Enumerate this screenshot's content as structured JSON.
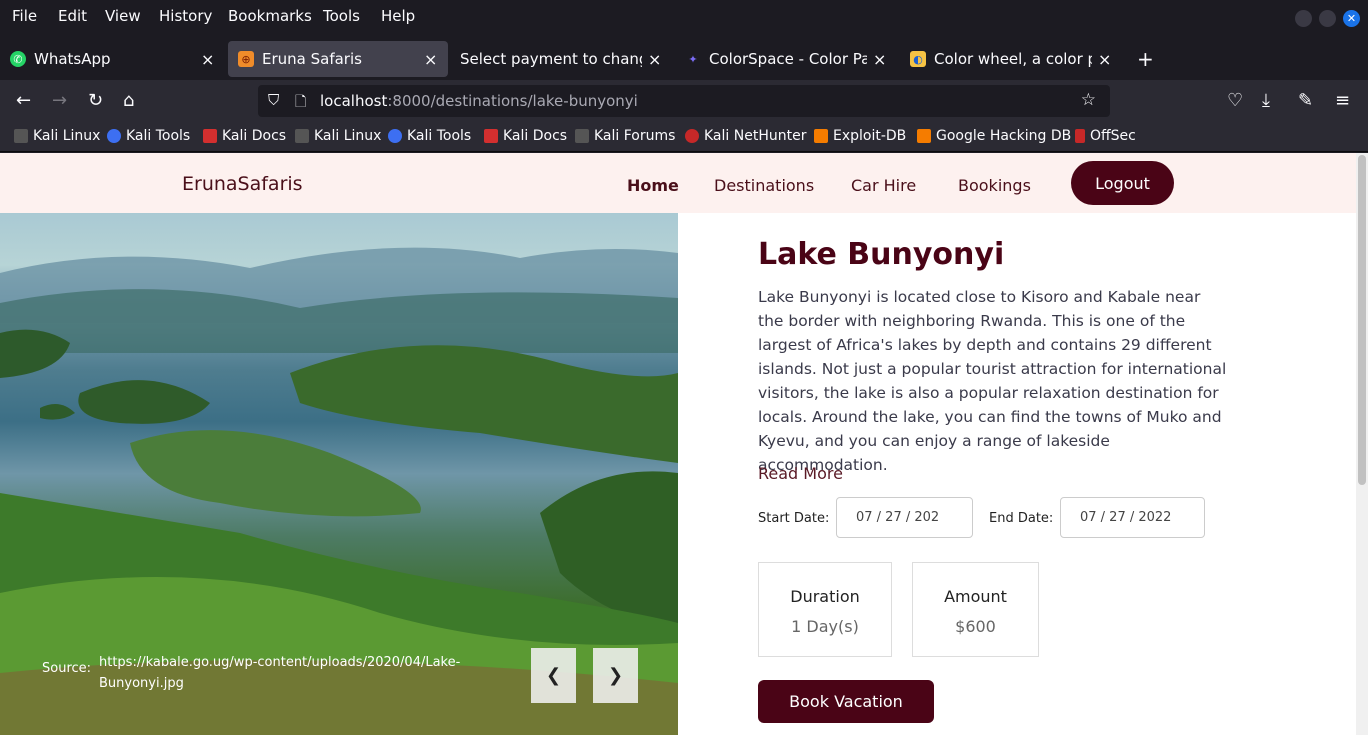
{
  "menu": [
    "File",
    "Edit",
    "View",
    "History",
    "Bookmarks",
    "Tools",
    "Help"
  ],
  "tabs": [
    {
      "label": "WhatsApp",
      "icon": "whatsapp-icon"
    },
    {
      "label": "Eruna Safaris",
      "icon": "site-favicon"
    },
    {
      "label": "Select payment to change | D",
      "icon": "none"
    },
    {
      "label": "ColorSpace - Color Palett",
      "icon": "colorspace-icon"
    },
    {
      "label": "Color wheel, a color palet",
      "icon": "colorwheel-icon"
    }
  ],
  "url": {
    "host": "localhost",
    "path": ":8000/destinations/lake-bunyonyi"
  },
  "bookmarks": [
    "Kali Linux",
    "Kali Tools",
    "Kali Docs",
    "Kali Linux",
    "Kali Tools",
    "Kali Docs",
    "Kali Forums",
    "Kali NetHunter",
    "Exploit-DB",
    "Google Hacking DB",
    "OffSec"
  ],
  "site": {
    "brand": "ErunaSafaris",
    "nav": [
      "Home",
      "Destinations",
      "Car Hire",
      "Bookings"
    ],
    "logout": "Logout"
  },
  "hero": {
    "source_label": "Source:",
    "source_url": "https://kabale.go.ug/wp-content/uploads/2020/04/Lake-Bunyonyi.jpg",
    "prev": "❮",
    "next": "❯"
  },
  "destination": {
    "title": "Lake Bunyonyi",
    "description": "Lake Bunyonyi is located close to Kisoro and Kabale near the border with neighboring Rwanda. This is one of the largest of Africa's lakes by depth and contains 29 different islands. Not just a popular tourist attraction for international visitors, the lake is also a popular relaxation destination for locals. Around the lake, you can find the towns of Muko and Kyevu, and you can enjoy a range of lakeside accommodation.",
    "read_more": "Read More",
    "start_label": "Start Date:",
    "start_value": "07 / 27 / 202",
    "end_label": "End Date:",
    "end_value": "07 / 27 / 2022",
    "duration_label": "Duration",
    "duration_value": "1 Day(s)",
    "amount_label": "Amount",
    "amount_value": "$600",
    "book": "Book Vacation"
  },
  "colors": {
    "brand": "#4a0416",
    "header_bg": "#fdf1ef",
    "chrome_bg": "#1c1b22"
  }
}
